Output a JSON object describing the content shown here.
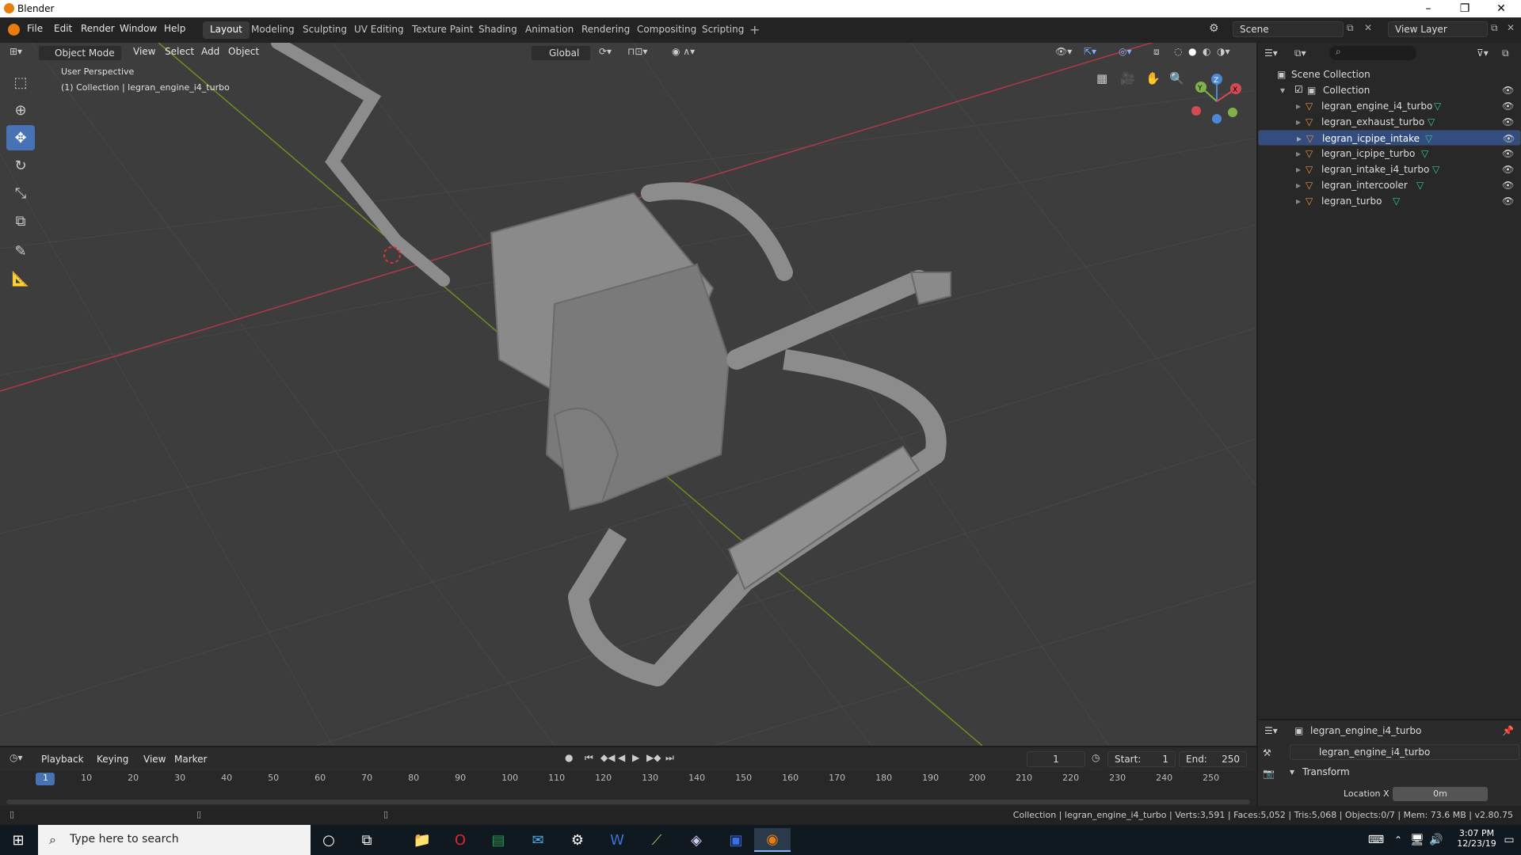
{
  "window": {
    "title": "Blender",
    "controls": [
      "–",
      "❐",
      "✕"
    ]
  },
  "menu": [
    "File",
    "Edit",
    "Render",
    "Window",
    "Help"
  ],
  "workspaces": [
    "Layout",
    "Modeling",
    "Sculpting",
    "UV Editing",
    "Texture Paint",
    "Shading",
    "Animation",
    "Rendering",
    "Compositing",
    "Scripting"
  ],
  "active_workspace": "Layout",
  "scene": {
    "name": "Scene",
    "view_layer": "View Layer"
  },
  "viewport": {
    "mode": "Object Mode",
    "menus": [
      "View",
      "Select",
      "Add",
      "Object"
    ],
    "orientation": "Global",
    "overlay_line1": "User Perspective",
    "overlay_line2": "(1) Collection | legran_engine_i4_turbo",
    "gizmo": {
      "z": "Z",
      "y": "Y",
      "x": "X"
    }
  },
  "outliner": {
    "root": "Scene Collection",
    "collection": "Collection",
    "items": [
      {
        "name": "legran_engine_i4_turbo",
        "selected": false
      },
      {
        "name": "legran_exhaust_turbo",
        "selected": false
      },
      {
        "name": "legran_icpipe_intake",
        "selected": true
      },
      {
        "name": "legran_icpipe_turbo",
        "selected": false
      },
      {
        "name": "legran_intake_i4_turbo",
        "selected": false
      },
      {
        "name": "legran_intercooler",
        "selected": false
      },
      {
        "name": "legran_turbo",
        "selected": false
      }
    ]
  },
  "properties": {
    "object": "legran_engine_i4_turbo",
    "data_name": "legran_engine_i4_turbo",
    "panel": "Transform",
    "field_label": "Location X",
    "field_value": "0m"
  },
  "timeline": {
    "menus": [
      "Playback",
      "Keying",
      "View",
      "Marker"
    ],
    "current_frame": "1",
    "start_label": "Start:",
    "start": "1",
    "end_label": "End:",
    "end": "250",
    "ticks": [
      "1",
      "10",
      "20",
      "30",
      "40",
      "50",
      "60",
      "70",
      "80",
      "90",
      "100",
      "110",
      "120",
      "130",
      "140",
      "150",
      "160",
      "170",
      "180",
      "190",
      "200",
      "210",
      "220",
      "230",
      "240",
      "250"
    ]
  },
  "status": "Collection | legran_engine_i4_turbo | Verts:3,591 | Faces:5,052 | Tris:5,068 | Objects:0/7 | Mem: 73.6 MB | v2.80.75",
  "taskbar": {
    "search_placeholder": "Type here to search",
    "time": "3:07 PM",
    "date": "12/23/19"
  },
  "colors": {
    "accent": "#4772b3",
    "select": "#334d80",
    "object_icon": "#e8913b",
    "mesh_icon": "#37c88f"
  }
}
